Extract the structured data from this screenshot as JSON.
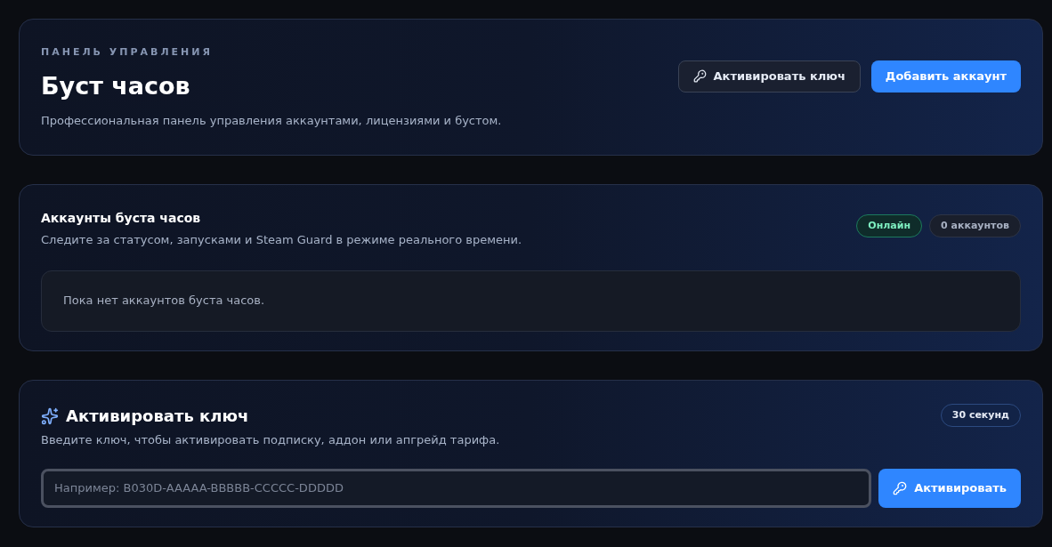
{
  "header": {
    "eyebrow": "ПАНЕЛЬ УПРАВЛЕНИЯ",
    "title": "Буст часов",
    "subtitle": "Профессиональная панель управления аккаунтами, лицензиями и бустом.",
    "buttons": [
      {
        "label": "Активировать ключ",
        "kind": "secondary"
      },
      {
        "label": "Добавить аккаунт",
        "kind": "primary"
      }
    ]
  },
  "accounts": {
    "title": "Аккаунты буста часов",
    "subtitle": "Следите за статусом, запусками и Steam Guard в режиме реального времени.",
    "badges": [
      {
        "label": "Онлайн",
        "kind": "success"
      },
      {
        "label": "0 аккаунтов",
        "kind": "neutral"
      }
    ],
    "empty_text": "Пока нет аккаунтов буста часов."
  },
  "activate": {
    "title": "Активировать ключ",
    "subtitle": "Введите ключ, чтобы активировать подписку, аддон или апгрейд тарифа.",
    "badge": "30 секунд",
    "field": {
      "placeholder": "Например: B030D-AAAAA-BBBBB-CCCCC-DDDDD",
      "focused": true
    },
    "button": "Активировать"
  }
}
